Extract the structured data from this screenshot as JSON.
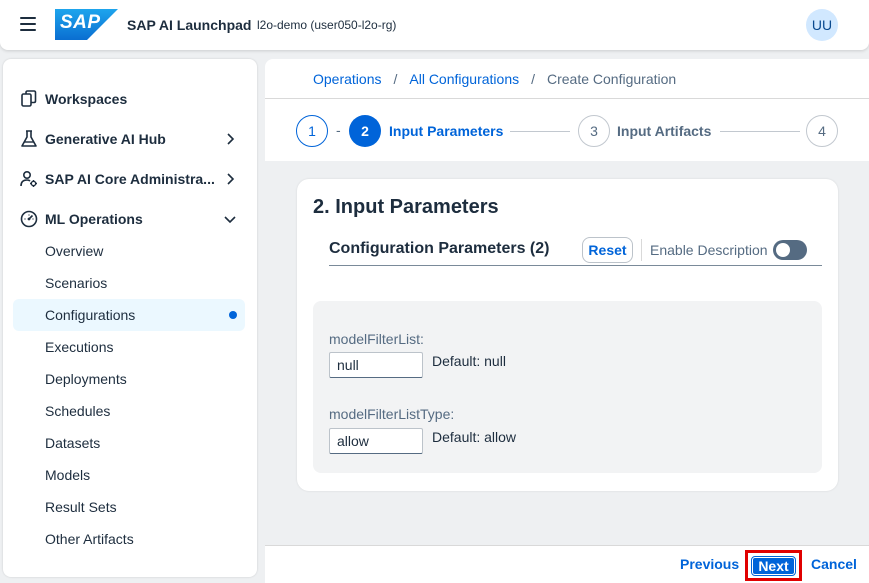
{
  "shell": {
    "brand": "SAP",
    "app_title": "SAP AI Launchpad",
    "subtitle": "l2o-demo (user050-l2o-rg)",
    "avatar_initials": "UU"
  },
  "sidebar": {
    "items": [
      {
        "label": "Workspaces",
        "icon": "workspaces-icon"
      },
      {
        "label": "Generative AI Hub",
        "icon": "flask-icon"
      },
      {
        "label": "SAP AI Core Administra...",
        "icon": "person-gear-icon"
      },
      {
        "label": "ML Operations",
        "icon": "dashboard-gauge-icon"
      }
    ],
    "sub_items": [
      {
        "label": "Overview"
      },
      {
        "label": "Scenarios"
      },
      {
        "label": "Configurations"
      },
      {
        "label": "Executions"
      },
      {
        "label": "Deployments"
      },
      {
        "label": "Schedules"
      },
      {
        "label": "Datasets"
      },
      {
        "label": "Models"
      },
      {
        "label": "Result Sets"
      },
      {
        "label": "Other Artifacts"
      }
    ]
  },
  "breadcrumb": {
    "items": [
      "Operations",
      "All Configurations"
    ],
    "separator": "/",
    "current": "Create Configuration"
  },
  "wizard": {
    "steps": [
      {
        "number": "1",
        "label": ""
      },
      {
        "number": "2",
        "label": "Input Parameters"
      },
      {
        "number": "3",
        "label": "Input Artifacts"
      },
      {
        "number": "4",
        "label": ""
      }
    ],
    "dash": "-"
  },
  "form": {
    "title": "2. Input Parameters",
    "section_title": "Configuration Parameters (2)",
    "reset_label": "Reset",
    "enable_description_label": "Enable Description",
    "enable_description_on": false,
    "params": [
      {
        "label": "modelFilterList:",
        "value": "null",
        "default": "Default: null"
      },
      {
        "label": "modelFilterListType:",
        "value": "allow",
        "default": "Default: allow"
      }
    ]
  },
  "footer": {
    "previous_label": "Previous",
    "next_label": "Next",
    "cancel_label": "Cancel"
  },
  "colors": {
    "accent": "#0064d9",
    "highlight_border": "#e00000",
    "selected_bg": "#ebf8ff"
  }
}
